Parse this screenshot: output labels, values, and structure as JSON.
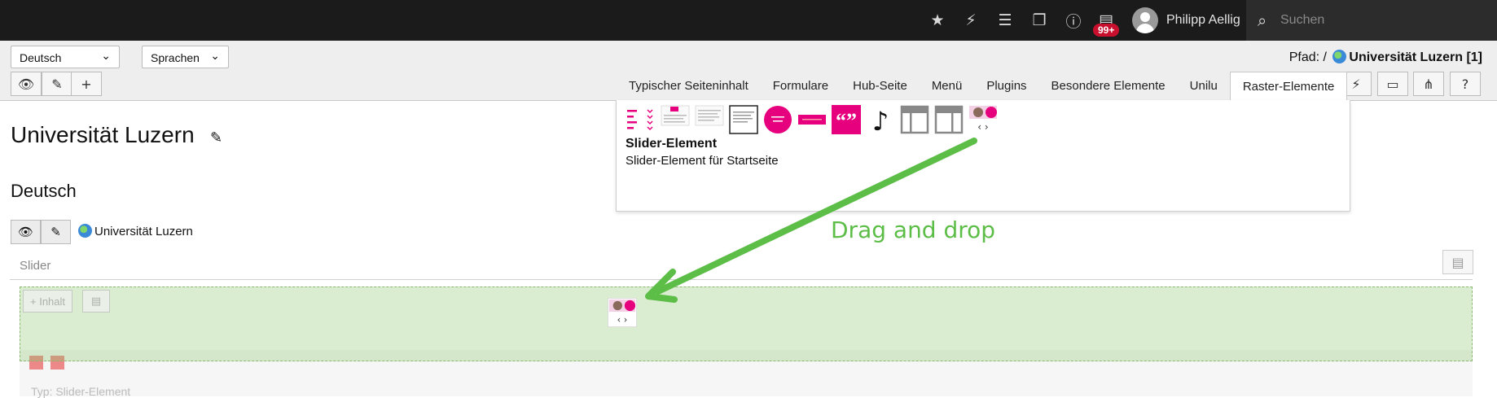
{
  "topbar": {
    "icons": [
      "star-icon",
      "bolt-icon",
      "server-icon",
      "copy-icon",
      "help-icon",
      "list-icon"
    ],
    "badge": "99+",
    "username": "Philipp Aellig",
    "search_placeholder": "Suchen"
  },
  "docheader": {
    "language_select": "Deutsch",
    "languages_select": "Sprachen",
    "path_label": "Pfad: /",
    "path_value": "Universität Luzern [1]"
  },
  "tabs": [
    {
      "label": "Typischer Seiteninhalt",
      "active": false
    },
    {
      "label": "Formulare",
      "active": false
    },
    {
      "label": "Hub-Seite",
      "active": false
    },
    {
      "label": "Menü",
      "active": false
    },
    {
      "label": "Plugins",
      "active": false
    },
    {
      "label": "Besondere Elemente",
      "active": false
    },
    {
      "label": "Unilu",
      "active": false
    },
    {
      "label": "Raster-Elemente",
      "active": true
    }
  ],
  "wizard": {
    "title": "Slider-Element",
    "description": "Slider-Element für Startseite",
    "quote_glyph": "“”",
    "music_glyph": "♪",
    "slider_arrows": "‹ ›"
  },
  "page": {
    "title": "Universität Luzern",
    "language_heading": "Deutsch",
    "page_link": "Universität Luzern",
    "column_header": "Slider",
    "ghost_add": "+ Inhalt",
    "lower_text": "Typ: Slider-Element"
  },
  "annotation": "Drag and drop",
  "colors": {
    "accent": "#e6007e",
    "annotation": "#5cbd47",
    "topbar": "#1b1b1b"
  }
}
